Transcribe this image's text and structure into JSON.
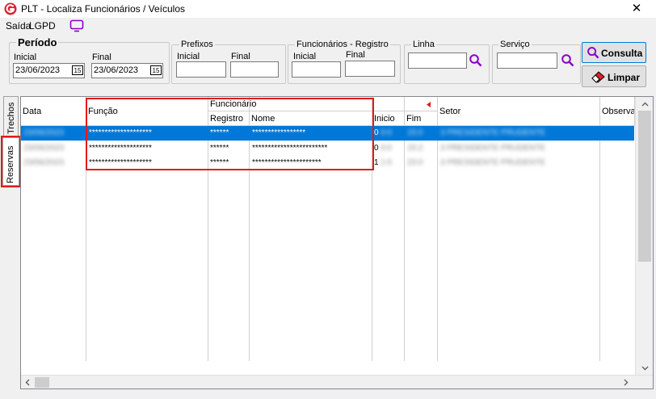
{
  "window": {
    "title": "PLT - Localiza Funcionários / Veículos",
    "close_label": "✕"
  },
  "menu": {
    "saida": "Saída",
    "lgpd": "LGPD"
  },
  "periodo": {
    "title": "Período",
    "inicial_label": "Inicial",
    "final_label": "Final",
    "inicial_value": "23/06/2023",
    "final_value": "23/06/2023",
    "cal_icon": "15"
  },
  "prefixos": {
    "title": "Prefixos",
    "inicial_label": "Inicial",
    "final_label": "Final"
  },
  "funcionarios": {
    "title": "Funcionários - Registro",
    "inicial_label": "Inicial",
    "final_label": "Final"
  },
  "linha": {
    "title": "Linha"
  },
  "servico": {
    "title": "Serviço"
  },
  "buttons": {
    "consulta": "Consulta",
    "limpar": "Limpar"
  },
  "tabs": {
    "trechos": "Trechos",
    "reservas": "Reservas"
  },
  "grid": {
    "headers": {
      "data": "Data",
      "funcao": "Função",
      "funcionario": "Funcionário",
      "registro": "Registro",
      "nome": "Nome",
      "inicio": "Inicio",
      "fim": "Fim",
      "setor": "Setor",
      "observacao": "Observa"
    },
    "rows": [
      {
        "data": "23/06/2023",
        "funcao": "********************",
        "registro": "******",
        "nome": "*****************",
        "inicio": "0",
        "inicio_blur": "0:0",
        "fim": "15:0",
        "setor": "3 PRESIDENTE PRUDENTE"
      },
      {
        "data": "23/06/2023",
        "funcao": "********************",
        "registro": "******",
        "nome": "************************",
        "inicio": "0",
        "inicio_blur": "0:0",
        "fim": "15:2",
        "setor": "3 PRESIDENTE PRUDENTE"
      },
      {
        "data": "23/06/2023",
        "funcao": "********************",
        "registro": "******",
        "nome": "**********************",
        "inicio": "1",
        "inicio_blur": "1:0",
        "fim": "23:0",
        "setor": "3 PRESIDENTE PRUDENTE"
      }
    ]
  },
  "colors": {
    "selection": "#0078d7",
    "highlight_box": "#e11b1b",
    "accent_purple": "#8b00c8"
  }
}
